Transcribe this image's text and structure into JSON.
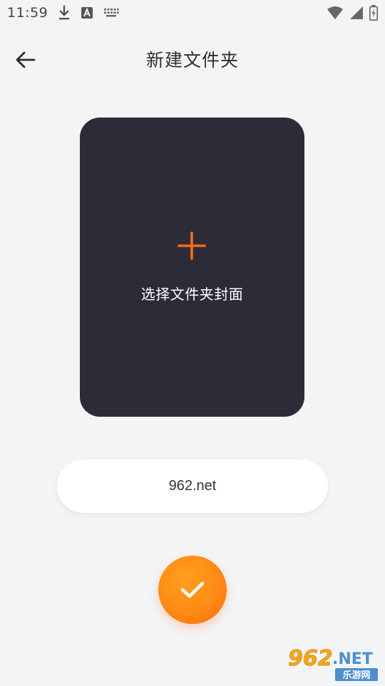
{
  "status_bar": {
    "time": "11:59",
    "icons": [
      "download-icon",
      "font-a-icon",
      "keyboard-icon",
      "wifi-icon",
      "signal-icon",
      "battery-icon"
    ]
  },
  "header": {
    "title": "新建文件夹",
    "back_icon": "arrow-left-icon"
  },
  "cover": {
    "label": "选择文件夹封面",
    "icon": "plus-icon"
  },
  "name_field": {
    "value": "962.net"
  },
  "confirm": {
    "icon": "check-icon"
  },
  "watermark": {
    "brand": "962.NET",
    "subtitle": "乐游网"
  },
  "colors": {
    "background": "#f3f4f6",
    "card": "#2c2c38",
    "accent": "#ff8a14",
    "plus": "#ff6a13"
  }
}
